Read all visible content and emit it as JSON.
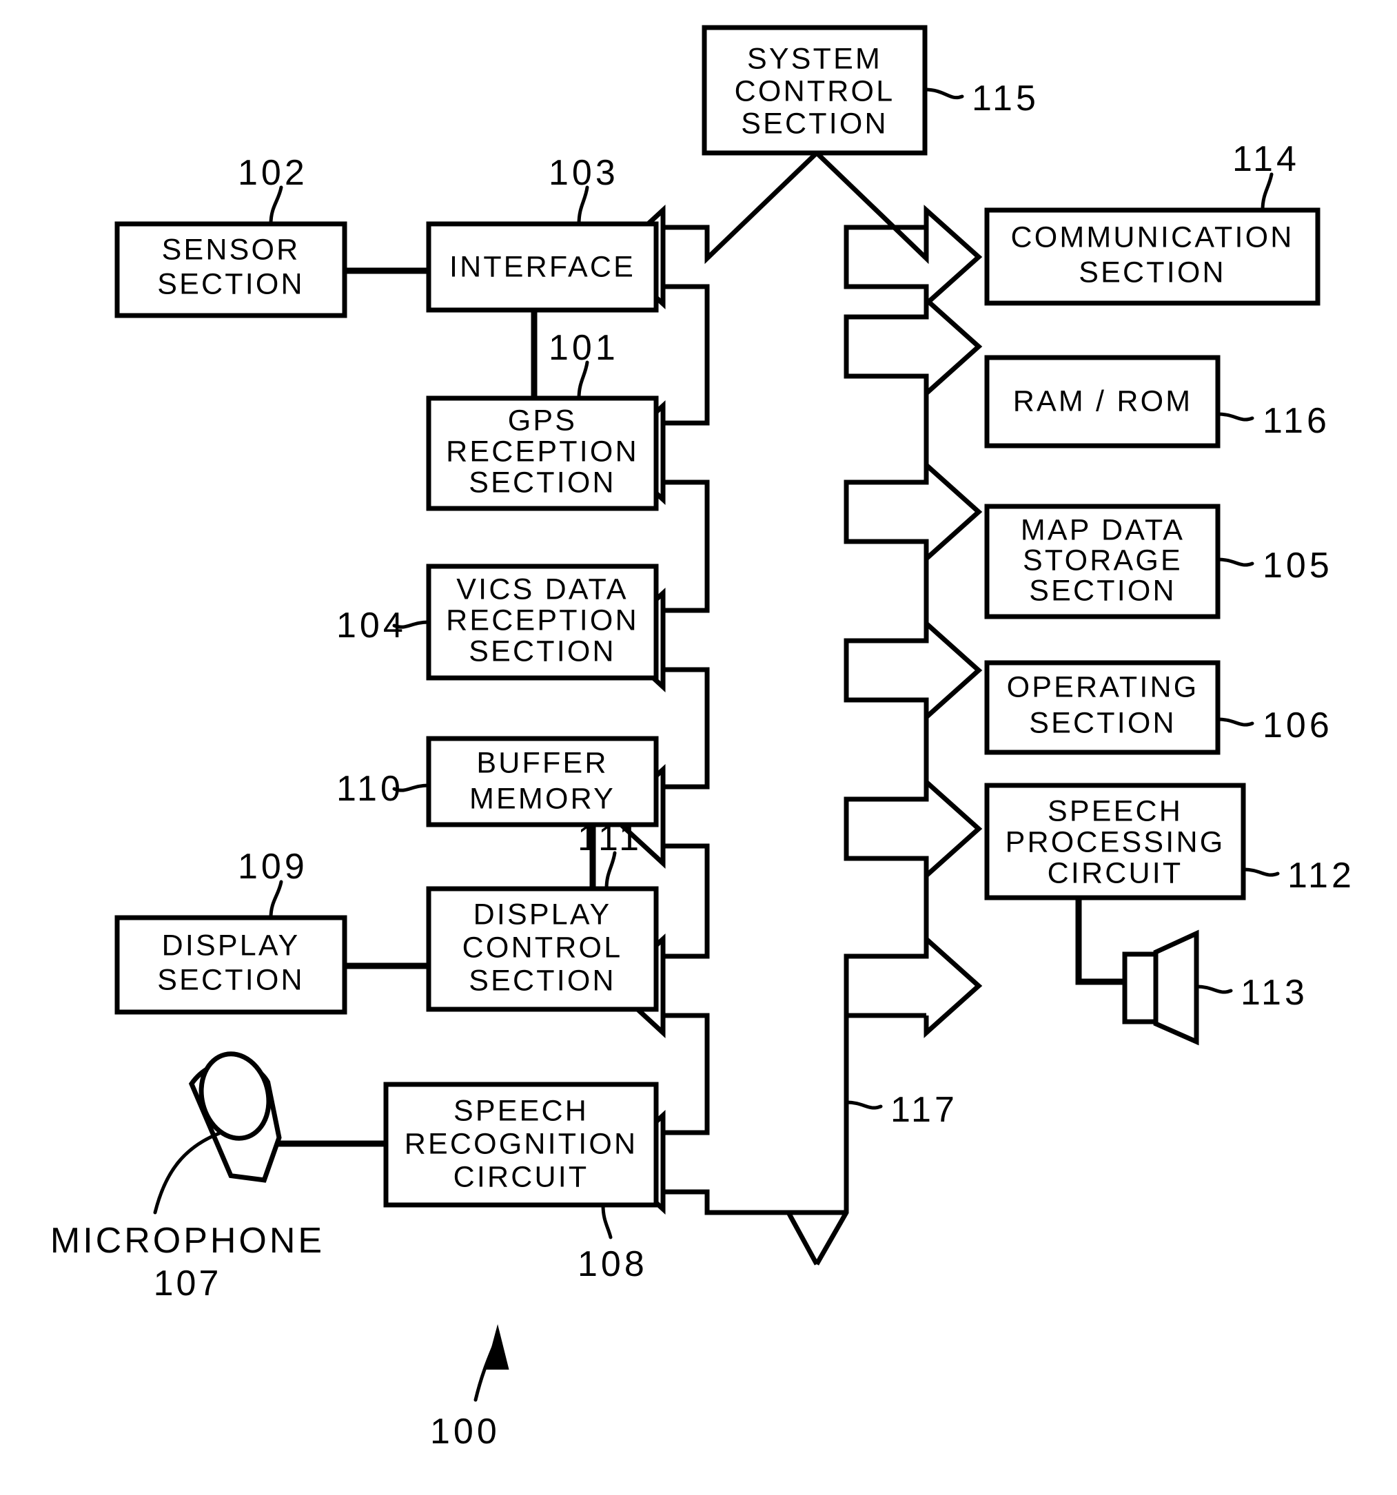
{
  "figure": {
    "type": "patent-block-diagram",
    "overall_label": "100",
    "bus_label": "117"
  },
  "blocks": [
    {
      "id": "system_control",
      "ref": "115",
      "lines": [
        "SYSTEM",
        "CONTROL",
        "SECTION"
      ]
    },
    {
      "id": "sensor",
      "ref": "102",
      "lines": [
        "SENSOR",
        "SECTION"
      ]
    },
    {
      "id": "interface",
      "ref": "103",
      "lines": [
        "INTERFACE"
      ]
    },
    {
      "id": "gps",
      "ref": "101",
      "lines": [
        "GPS",
        "RECEPTION",
        "SECTION"
      ]
    },
    {
      "id": "vics",
      "ref": "104",
      "lines": [
        "VICS DATA",
        "RECEPTION",
        "SECTION"
      ]
    },
    {
      "id": "buffer",
      "ref": "110",
      "lines": [
        "BUFFER",
        "MEMORY"
      ]
    },
    {
      "id": "display",
      "ref": "109",
      "lines": [
        "DISPLAY",
        "SECTION"
      ]
    },
    {
      "id": "display_ctrl",
      "ref": "111",
      "lines": [
        "DISPLAY",
        "CONTROL",
        "SECTION"
      ]
    },
    {
      "id": "speech_recog",
      "ref": "108",
      "lines": [
        "SPEECH",
        "RECOGNITION",
        "CIRCUIT"
      ]
    },
    {
      "id": "communication",
      "ref": "114",
      "lines": [
        "COMMUNICATION",
        "SECTION"
      ]
    },
    {
      "id": "ramrom",
      "ref": "116",
      "lines": [
        "RAM / ROM"
      ]
    },
    {
      "id": "map_data",
      "ref": "105",
      "lines": [
        "MAP DATA",
        "STORAGE",
        "SECTION"
      ]
    },
    {
      "id": "operating",
      "ref": "106",
      "lines": [
        "OPERATING",
        "SECTION"
      ]
    },
    {
      "id": "speech_proc",
      "ref": "112",
      "lines": [
        "SPEECH",
        "PROCESSING",
        "CIRCUIT"
      ]
    }
  ],
  "icons": [
    {
      "id": "microphone",
      "ref": "107",
      "label": "MICROPHONE"
    },
    {
      "id": "speaker",
      "ref": "113",
      "label": ""
    }
  ],
  "colors": {
    "ink": "#000000",
    "paper": "#ffffff"
  }
}
